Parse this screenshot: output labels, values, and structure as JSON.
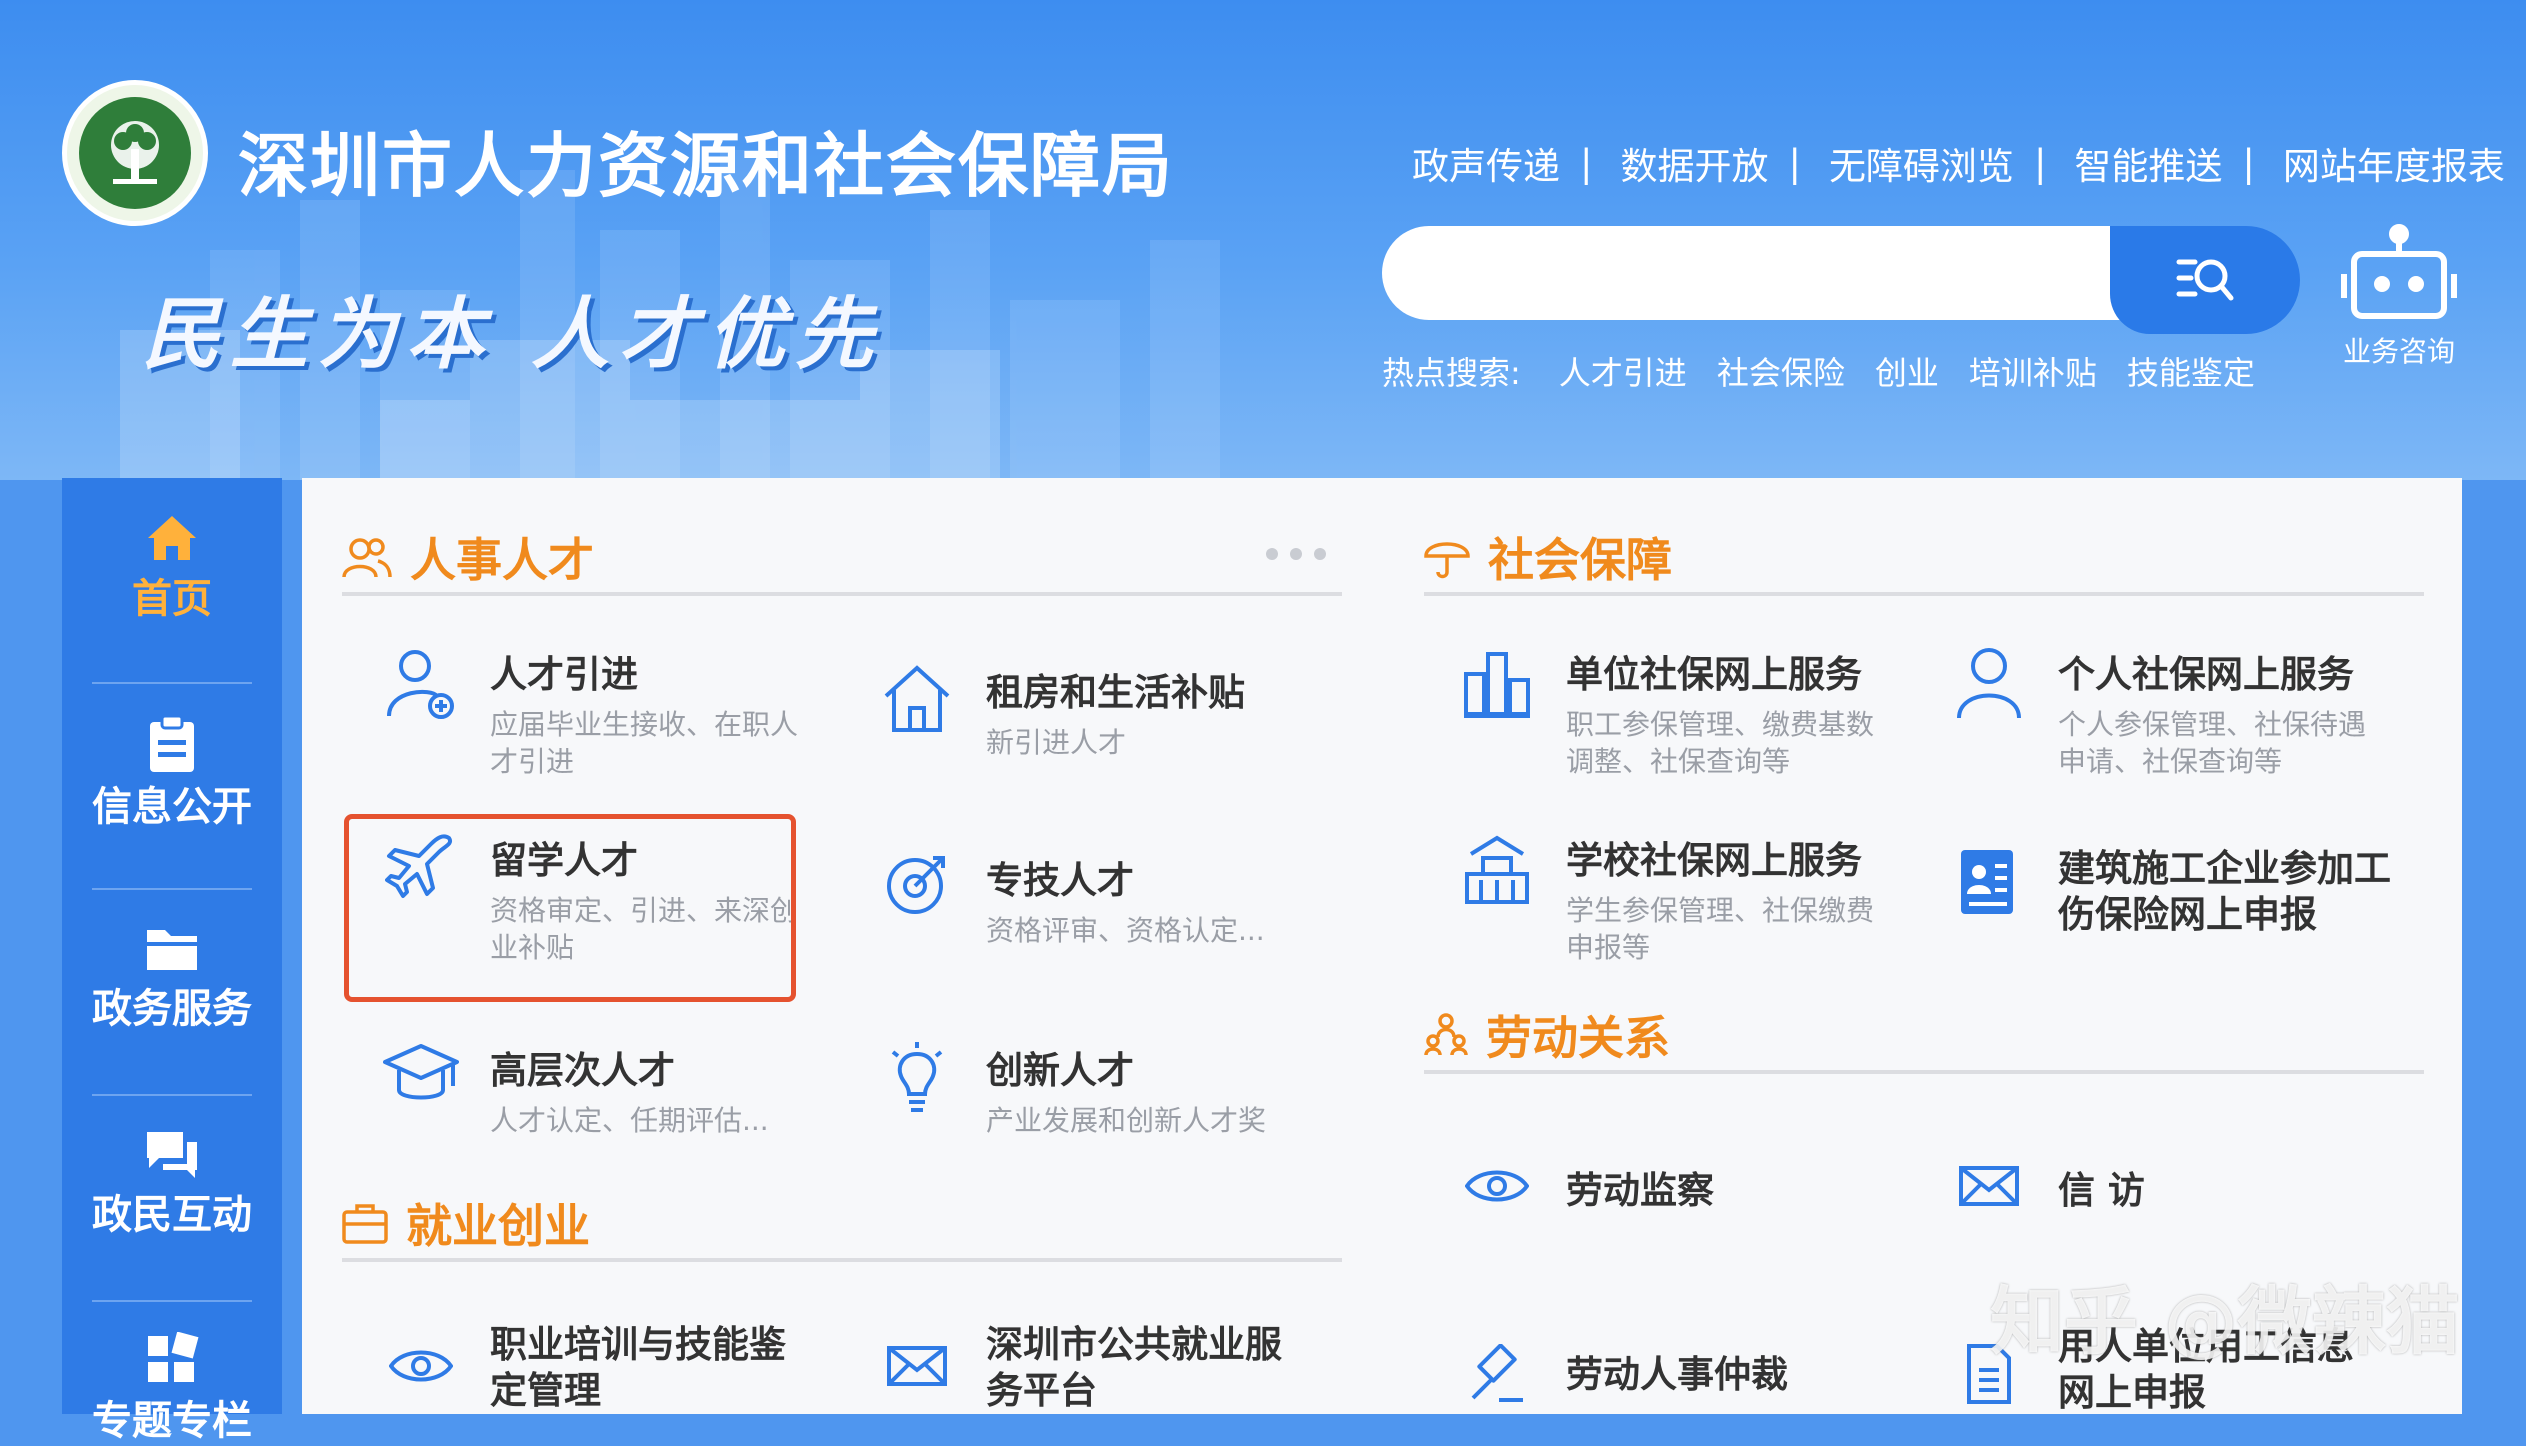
{
  "header": {
    "site_title": "深圳市人力资源和社会保障局",
    "slogan": "民生为本 人才优先",
    "top_links": [
      "政声传递",
      "数据开放",
      "无障碍浏览",
      "智能推送",
      "网站年度报表"
    ],
    "link_separator": "|",
    "search": {
      "placeholder": "",
      "value": ""
    },
    "hot_search": {
      "label": "热点搜索:",
      "tags": [
        "人才引进",
        "社会保险",
        "创业",
        "培训补贴",
        "技能鉴定"
      ]
    },
    "consult_label": "业务咨询"
  },
  "sidebar": {
    "items": [
      {
        "label": "首页",
        "icon": "home-icon",
        "active": true
      },
      {
        "label": "信息公开",
        "icon": "clipboard-icon"
      },
      {
        "label": "政务服务",
        "icon": "folder-icon"
      },
      {
        "label": "政民互动",
        "icon": "chat-icon"
      },
      {
        "label": "专题专栏",
        "icon": "grid-icon"
      }
    ]
  },
  "sections": {
    "talent": {
      "title": "人事人才",
      "cards": [
        {
          "title": "人才引进",
          "desc": "应届毕业生接收、在职人才引进",
          "icon": "person-plus-icon"
        },
        {
          "title": "租房和生活补贴",
          "desc": "新引进人才",
          "icon": "house-icon"
        },
        {
          "title": "留学人才",
          "desc": "资格审定、引进、来深创业补贴",
          "icon": "airplane-icon"
        },
        {
          "title": "专技人才",
          "desc": "资格评审、资格认定...",
          "icon": "target-icon"
        },
        {
          "title": "高层次人才",
          "desc": "人才认定、任期评估...",
          "icon": "graduation-cap-icon"
        },
        {
          "title": "创新人才",
          "desc": "产业发展和创新人才奖",
          "icon": "lightbulb-icon"
        }
      ]
    },
    "employment": {
      "title": "就业创业",
      "cards": [
        {
          "title": "职业培训与技能鉴定管理",
          "icon": "eye-icon"
        },
        {
          "title": "深圳市公共就业服务平台",
          "icon": "mail-icon"
        }
      ]
    },
    "social": {
      "title": "社会保障",
      "cards": [
        {
          "title": "单位社保网上服务",
          "desc": "职工参保管理、缴费基数调整、社保查询等",
          "icon": "building-chart-icon"
        },
        {
          "title": "个人社保网上服务",
          "desc": "个人参保管理、社保待遇申请、社保查询等",
          "icon": "person-icon"
        },
        {
          "title": "学校社保网上服务",
          "desc": "学生参保管理、社保缴费申报等",
          "icon": "school-icon"
        },
        {
          "title": "建筑施工企业参加工伤保险网上申报",
          "icon": "id-card-icon"
        }
      ]
    },
    "labor": {
      "title": "劳动关系",
      "cards": [
        {
          "title": "劳动监察",
          "icon": "eye-icon"
        },
        {
          "title": "信 访",
          "icon": "mail-icon"
        },
        {
          "title": "劳动人事仲裁",
          "icon": "gavel-icon"
        },
        {
          "title": "用人单位用工信息网上申报",
          "icon": "document-icon"
        }
      ]
    }
  },
  "watermark": "知乎 @微辣猫",
  "colors": {
    "header_blue": "#3d8df0",
    "sidebar_blue": "#2f7be6",
    "accent_orange": "#f08a1d",
    "icon_blue": "#2f7be6",
    "highlight_red": "#e5522f"
  }
}
